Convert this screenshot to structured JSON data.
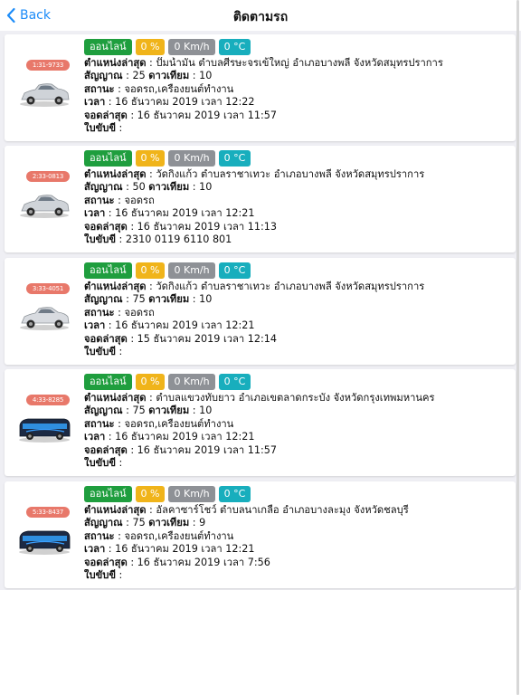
{
  "nav": {
    "back_label": "Back",
    "title": "ติดตามรถ"
  },
  "labels": {
    "location": "ตำแหน่งล่าสุด",
    "signal": "สัญญาณ",
    "satellite": "ดาวเทียม",
    "status": "สถานะ",
    "time": "เวลา",
    "last_parked": "จอดล่าสุด",
    "license": "ใบขับขี่"
  },
  "colors": {
    "online": "#1f9e3e",
    "battery": "#f0b41a",
    "speed": "#8e9196",
    "temperature": "#18aebd",
    "plate": "#e8786a",
    "accent": "#1d8cf8"
  },
  "vehicles": [
    {
      "plate": "1:31-9733",
      "icon": "sedan-car-icon",
      "online": "ออนไลน์",
      "battery": "0 %",
      "speed": "0 Km/h",
      "temperature": "0 °C",
      "location": "ปั๊มน้ำมัน ตำบลศีรษะจรเข้ใหญ่ อำเภอบางพลี จังหวัดสมุทรปราการ",
      "signal": "25",
      "satellite": "10",
      "status": "จอดรถ,เครื่องยนต์ทำงาน",
      "time": "16 ธันวาคม 2019 เวลา 12:22",
      "last_parked": "16 ธันวาคม 2019 เวลา 11:57",
      "license": ""
    },
    {
      "plate": "2:33-0813",
      "icon": "sedan-car-icon",
      "online": "ออนไลน์",
      "battery": "0 %",
      "speed": "0 Km/h",
      "temperature": "0 °C",
      "location": "วัดกิ่งแก้ว ตำบลราชาเทวะ อำเภอบางพลี จังหวัดสมุทรปราการ",
      "signal": "50",
      "satellite": "10",
      "status": "จอดรถ",
      "time": "16 ธันวาคม 2019 เวลา 12:21",
      "last_parked": "16 ธันวาคม 2019 เวลา 11:13",
      "license": "2310 0119 6110 801"
    },
    {
      "plate": "3:33-4051",
      "icon": "sedan-car-icon",
      "online": "ออนไลน์",
      "battery": "0 %",
      "speed": "0 Km/h",
      "temperature": "0 °C",
      "location": "วัดกิ่งแก้ว ตำบลราชาเทวะ อำเภอบางพลี จังหวัดสมุทรปราการ",
      "signal": "75",
      "satellite": "10",
      "status": "จอดรถ",
      "time": "16 ธันวาคม 2019 เวลา 12:21",
      "last_parked": "15 ธันวาคม 2019 เวลา 12:14",
      "license": ""
    },
    {
      "plate": "4:33-8285",
      "icon": "bus-icon",
      "online": "ออนไลน์",
      "battery": "0 %",
      "speed": "0 Km/h",
      "temperature": "0 °C",
      "location": "ตำบลแขวงทับยาว อำเภอเขตลาดกระบัง จังหวัดกรุงเทพมหานคร",
      "signal": "75",
      "satellite": "10",
      "status": "จอดรถ,เครื่องยนต์ทำงาน",
      "time": "16 ธันวาคม 2019 เวลา 12:21",
      "last_parked": "16 ธันวาคม 2019 เวลา 11:57",
      "license": ""
    },
    {
      "plate": "5:33-8437",
      "icon": "bus-icon",
      "online": "ออนไลน์",
      "battery": "0 %",
      "speed": "0 Km/h",
      "temperature": "0 °C",
      "location": "อัลคาซาร์โชว์ ตำบลนาเกลือ อำเภอบางละมุง จังหวัดชลบุรี",
      "signal": "75",
      "satellite": "9",
      "status": "จอดรถ,เครื่องยนต์ทำงาน",
      "time": "16 ธันวาคม 2019 เวลา 12:21",
      "last_parked": "16 ธันวาคม 2019 เวลา 7:56",
      "license": ""
    }
  ]
}
